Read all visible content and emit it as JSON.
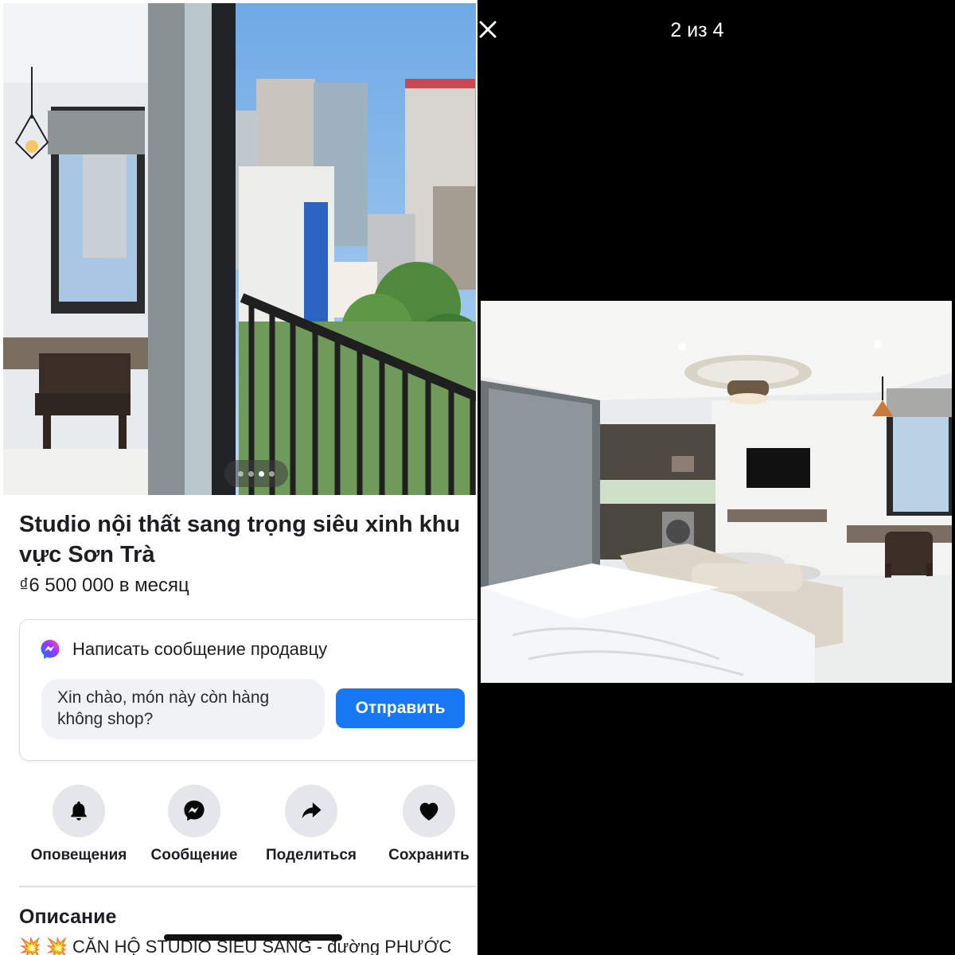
{
  "listing": {
    "title": "Studio nội thất sang trọng siêu xinh khu vực Sơn Trà",
    "price": "₫6 500 000 в месяц",
    "photo_indicator": {
      "count": 4,
      "active_index": 2
    }
  },
  "message_card": {
    "title": "Написать сообщение продавцу",
    "input_value": "Xin chào, món này còn hàng không shop?",
    "send_label": "Отправить"
  },
  "actions": [
    {
      "label": "Оповещения",
      "icon": "bell-icon"
    },
    {
      "label": "Сообщение",
      "icon": "messenger-icon"
    },
    {
      "label": "Поделиться",
      "icon": "share-icon"
    },
    {
      "label": "Сохранить",
      "icon": "heart-icon"
    }
  ],
  "description": {
    "heading": "Описание",
    "text": "💥 💥 CĂN HỘ STUDIO SIÊU SANG - đường PHƯỚC"
  },
  "viewer": {
    "counter": "2 из 4",
    "close_icon": "close-icon"
  },
  "colors": {
    "accent": "#1877f2",
    "icon_bg": "#e4e6eb",
    "viewer_bg": "#000000"
  }
}
